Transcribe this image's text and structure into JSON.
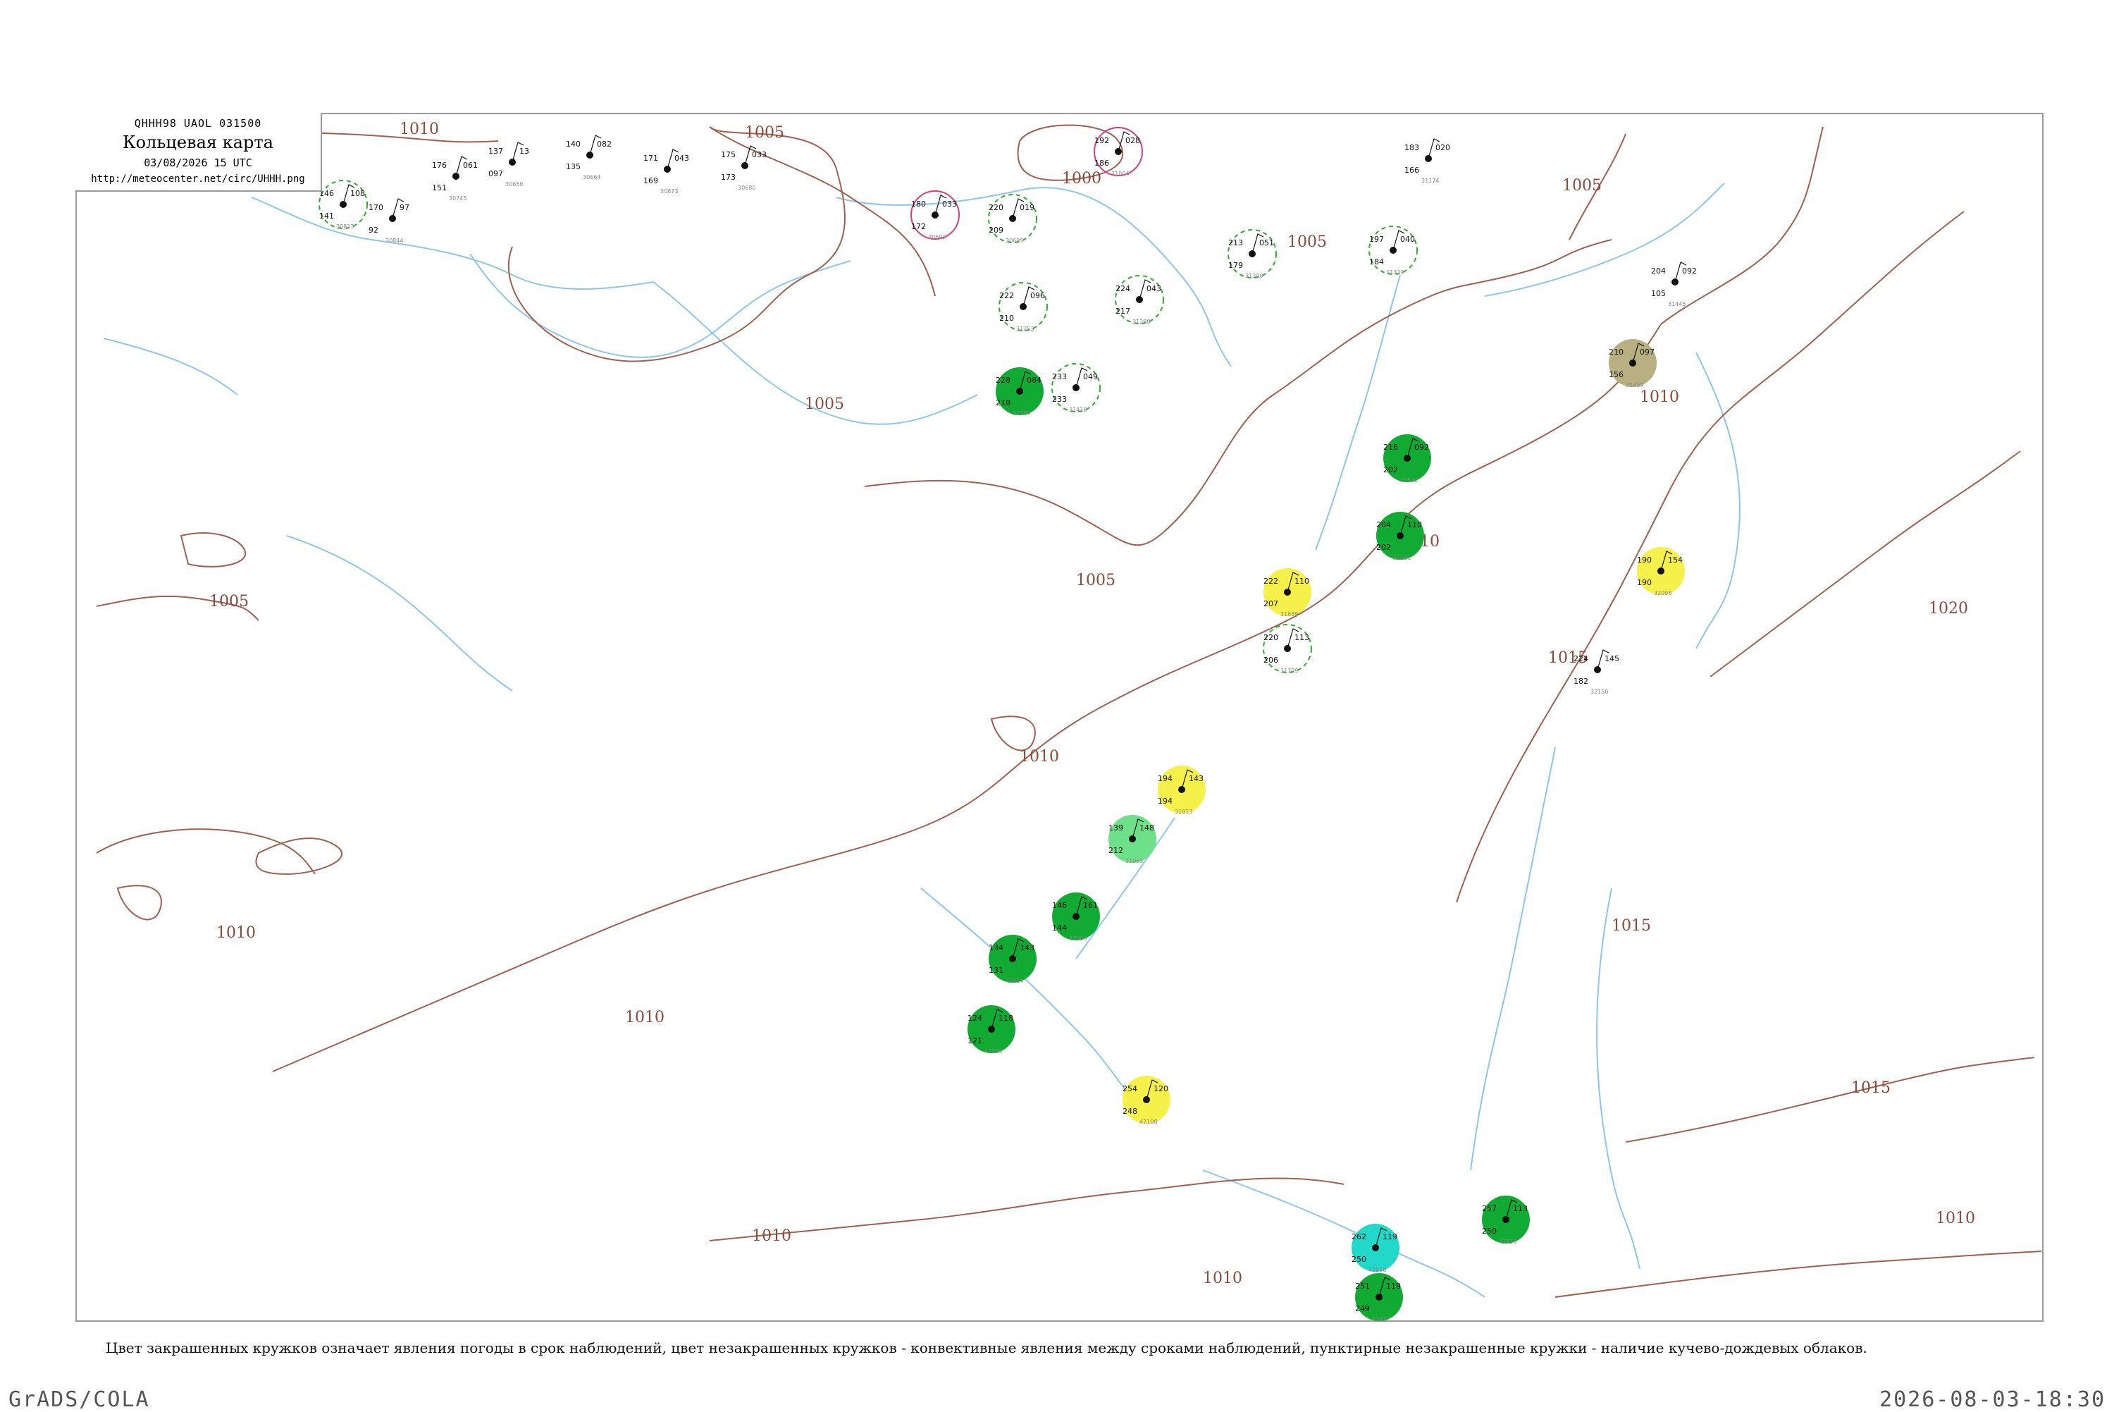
{
  "header": {
    "code": "QHHH98  UAOL  031500",
    "title": "Кольцевая карта",
    "datetime": "03/08/2026 15 UTC",
    "url": "http://meteocenter.net/circ/UHHH.png"
  },
  "caption": "Цвет закрашенных кружков означает явления погоды в срок наблюдений, цвет незакрашенных кружков - конвективные явления между сроками наблюдений, пунктирные незакрашенные кружки - наличие кучево-дождевых облаков.",
  "footer": {
    "left": "GrADS/COLA",
    "right": "2026-08-03-18:30"
  },
  "colors": {
    "isobar": "#a0604f",
    "river": "#8ec5ea",
    "frame": "#9a9a9a",
    "cb_circle": "#33aa33",
    "thunder_circle": "#d0407a",
    "rain": "#11aa33",
    "showers": "#f5f04a",
    "drizzle": "#6fe08a",
    "fog": "#b8b080",
    "cyan": "#22d8c8"
  },
  "isobar_labels": [
    "1010",
    "1005",
    "1005",
    "1005",
    "1000",
    "1005",
    "1005",
    "1010",
    "1010",
    "1005",
    "1010",
    "1015",
    "1010",
    "1020",
    "1015",
    "1015",
    "1010",
    "1010",
    "1010",
    "1010"
  ],
  "stations": [
    {
      "p": "146",
      "t": "141",
      "v": "108",
      "id": "30823"
    },
    {
      "p": "170",
      "t": "92",
      "v": "97",
      "id": "30844"
    },
    {
      "p": "176",
      "t": "151",
      "v": "061",
      "id": "30745"
    },
    {
      "p": "137",
      "t": "097",
      "v": "13",
      "id": "30650"
    },
    {
      "p": "140",
      "t": "135",
      "v": "082",
      "id": "30664"
    },
    {
      "p": "171",
      "t": "169",
      "v": "043",
      "id": "30673"
    },
    {
      "p": "175",
      "t": "173",
      "v": "033",
      "id": "30680"
    },
    {
      "p": "180",
      "t": "172",
      "v": "033",
      "id": "30692"
    },
    {
      "p": "220",
      "t": "209",
      "v": "019",
      "id": "30695"
    },
    {
      "p": "192",
      "t": "186",
      "v": "028",
      "id": "31004"
    },
    {
      "p": "183",
      "t": "166",
      "v": "020",
      "id": "31174"
    },
    {
      "p": "222",
      "t": "210",
      "v": "096",
      "id": "31253"
    },
    {
      "p": "224",
      "t": "217",
      "v": "043",
      "id": "31288"
    },
    {
      "p": "213",
      "t": "179",
      "v": "051",
      "id": "31300"
    },
    {
      "p": "197",
      "t": "184",
      "v": "040",
      "id": "31329"
    },
    {
      "p": "228",
      "t": "218",
      "v": "084",
      "id": "31369"
    },
    {
      "p": "233",
      "t": "233",
      "v": "049",
      "id": "31416"
    },
    {
      "p": "210",
      "t": "156",
      "v": "097",
      "id": "31439"
    },
    {
      "p": "204",
      "t": "105",
      "v": "092",
      "id": "31445"
    },
    {
      "p": "216",
      "t": "202",
      "v": "092",
      "id": "31532"
    },
    {
      "p": "204",
      "t": "202",
      "v": "110",
      "id": "31561"
    },
    {
      "p": "222",
      "t": "207",
      "v": "110",
      "id": "31689"
    },
    {
      "p": "220",
      "t": "206",
      "v": "113",
      "id": "31709"
    },
    {
      "p": "194",
      "t": "194",
      "v": "143",
      "id": "31913"
    },
    {
      "p": "139",
      "t": "212",
      "v": "148",
      "id": "31965"
    },
    {
      "p": "146",
      "t": "144",
      "v": "161",
      "id": "47003"
    },
    {
      "p": "134",
      "t": "131",
      "v": "143",
      "id": "47014"
    },
    {
      "p": "124",
      "t": "121",
      "v": "118",
      "id": "47055"
    },
    {
      "p": "254",
      "t": "248",
      "v": "120",
      "id": "47108"
    },
    {
      "p": "262",
      "t": "250",
      "v": "119",
      "id": "47808"
    },
    {
      "p": "251",
      "t": "249",
      "v": "119",
      "id": "47837"
    },
    {
      "p": "257",
      "t": "250",
      "v": "113",
      "id": "47830"
    },
    {
      "p": "190",
      "t": "190",
      "v": "154",
      "id": "32098"
    },
    {
      "p": "224",
      "t": "182",
      "v": "145",
      "id": "32150"
    }
  ]
}
